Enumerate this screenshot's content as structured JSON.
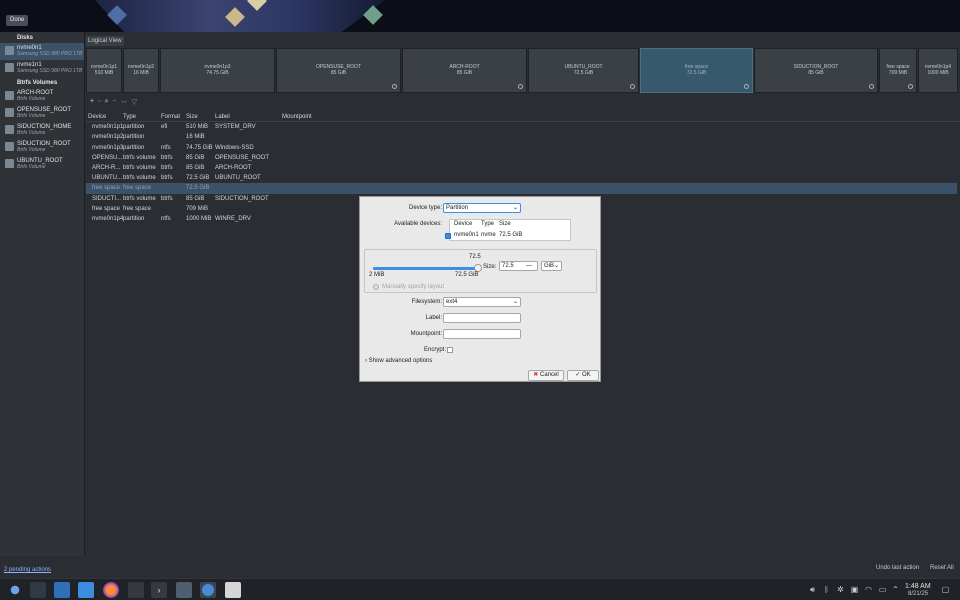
{
  "topbar": {
    "done_label": "Done"
  },
  "sidebar": {
    "disks_header": "Disks",
    "disks": [
      {
        "name": "nvme0n1",
        "detail": "Samsung SSD 980 PRO 1TB"
      },
      {
        "name": "nvme1n1",
        "detail": "Samsung SSD 980 PRO 1TB"
      }
    ],
    "btrfs_header": "Btrfs Volumes",
    "volumes": [
      {
        "name": "ARCH-ROOT",
        "detail": "Btrfs Volume"
      },
      {
        "name": "OPENSUSE_ROOT",
        "detail": "Btrfs Volume"
      },
      {
        "name": "SIDUCTION_HOME",
        "detail": "Btrfs Volume"
      },
      {
        "name": "SIDUCTION_ROOT",
        "detail": "Btrfs Volume"
      },
      {
        "name": "UBUNTU_ROOT",
        "detail": "Btrfs Volume"
      }
    ]
  },
  "main": {
    "logical_view_tab": "Logical View",
    "segments": [
      {
        "name": "nvme0n1p1",
        "size": "510 MiB"
      },
      {
        "name": "nvme0n1p2",
        "size": "16 MiB"
      },
      {
        "name": "nvme0n1p3",
        "size": "74.75 GiB"
      },
      {
        "name": "OPENSUSE_ROOT",
        "size": "85 GiB"
      },
      {
        "name": "ARCH-ROOT",
        "size": "85 GiB"
      },
      {
        "name": "UBUNTU_ROOT",
        "size": "72.5 GiB"
      },
      {
        "name": "free space",
        "size": "72.5 GiB"
      },
      {
        "name": "SIDUCTION_ROOT",
        "size": "85 GiB"
      },
      {
        "name": "free space",
        "size": "709 MiB"
      },
      {
        "name": "nvme0n1p4",
        "size": "1000 MiB"
      }
    ],
    "table": {
      "headers": [
        "Device",
        "Type",
        "Format",
        "Size",
        "Label",
        "Mountpoint"
      ],
      "rows": [
        [
          "nvme0n1p1",
          "partition",
          "efi",
          "510 MiB",
          "SYSTEM_DRV",
          ""
        ],
        [
          "nvme0n1p2",
          "partition",
          "",
          "16 MiB",
          "",
          ""
        ],
        [
          "nvme0n1p3",
          "partition",
          "ntfs",
          "74.75 GiB",
          "Windows-SSD",
          ""
        ],
        [
          "OPENSU...",
          "btrfs volume",
          "btrfs",
          "85 GiB",
          "OPENSUSE_ROOT",
          ""
        ],
        [
          "ARCH-R...",
          "btrfs volume",
          "btrfs",
          "85 GiB",
          "ARCH-ROOT",
          ""
        ],
        [
          "UBUNTU...",
          "btrfs volume",
          "btrfs",
          "72.5 GiB",
          "UBUNTU_ROOT",
          ""
        ],
        [
          "free space",
          "free space",
          "",
          "72.5 GiB",
          "",
          ""
        ],
        [
          "SIDUCTI...",
          "btrfs volume",
          "btrfs",
          "85 GiB",
          "SIDUCTION_ROOT",
          ""
        ],
        [
          "free space",
          "free space",
          "",
          "709 MiB",
          "",
          ""
        ],
        [
          "nvme0n1p4",
          "partition",
          "ntfs",
          "1000 MiB",
          "WINRE_DRV",
          ""
        ]
      ]
    },
    "pending_actions": "2 pending actions",
    "undo_label": "Undo last action",
    "reset_label": "Reset All"
  },
  "dialog": {
    "device_type_label": "Device type:",
    "device_type_value": "Partition",
    "available_devices_label": "Available devices:",
    "avail_headers": [
      "Device",
      "Type",
      "Size"
    ],
    "avail_row": {
      "device": "nvme0n1",
      "type": "nvme",
      "size": "72.5 GiB"
    },
    "slider_value": "72.5",
    "slider_fraction": 1.0,
    "size_min": "2 MiB",
    "size_max": "72.5 GiB",
    "size_label": "Size:",
    "size_value": "72.5",
    "size_unit": "GiB",
    "manual_layout": "Manually specify layout",
    "filesystem_label": "Filesystem:",
    "filesystem_value": "ext4",
    "label_label": "Label:",
    "label_value": "",
    "mountpoint_label": "Mountpoint:",
    "mountpoint_value": "",
    "encrypt_label": "Encrypt:",
    "advanced": "Show advanced options",
    "cancel_label": "Cancel",
    "ok_label": "OK"
  },
  "taskbar": {
    "time": "1:48 AM",
    "date": "8/21/25"
  }
}
